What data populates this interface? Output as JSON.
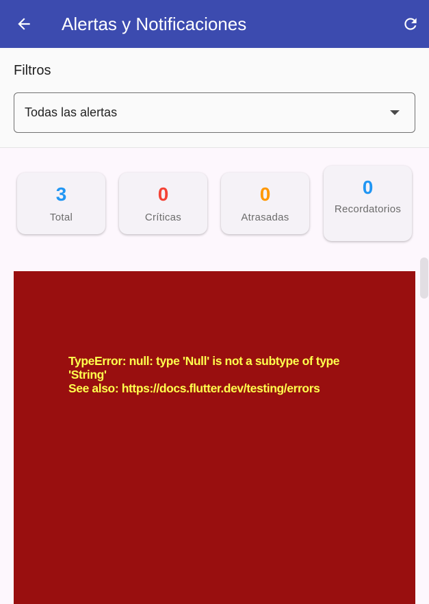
{
  "appbar": {
    "title": "Alertas y Notificaciones",
    "back_icon": "arrow-left-icon",
    "refresh_icon": "refresh-icon",
    "color": "#3c4baf"
  },
  "filters": {
    "label": "Filtros",
    "selected": "Todas las alertas"
  },
  "stats": [
    {
      "value": "3",
      "label": "Total",
      "color": "#2196f3"
    },
    {
      "value": "0",
      "label": "Críticas",
      "color": "#f44336"
    },
    {
      "value": "0",
      "label": "Atrasadas",
      "color": "#ff9800"
    },
    {
      "value": "0",
      "label": "Recordatorios",
      "color": "#2196f3"
    }
  ],
  "error": {
    "line1": "TypeError: null: type 'Null' is not a subtype of type",
    "line2": "'String'",
    "line3": "See also: https://docs.flutter.dev/testing/errors",
    "background": "#990f0f",
    "text_color": "#ffff4d"
  }
}
